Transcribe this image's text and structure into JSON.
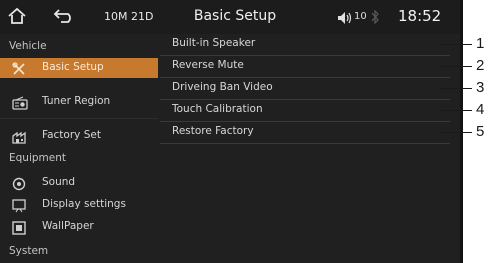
{
  "status_bar": {
    "home_icon": "home-icon",
    "back_icon": "back-arrow-icon",
    "date": "10M 21D",
    "title": "Basic Setup",
    "volume_icon": "speaker-icon",
    "volume": "10",
    "bluetooth_icon": "bluetooth-icon",
    "time": "18:52"
  },
  "sidebar": {
    "sections": [
      "Vehicle",
      "Equipment",
      "System"
    ],
    "items": [
      {
        "label": "Basic Setup",
        "icon": "wrench-screwdriver-icon",
        "selected": true
      },
      {
        "label": "Tuner Region",
        "icon": "radio-icon",
        "selected": false
      },
      {
        "label": "Factory Set",
        "icon": "factory-icon",
        "selected": false
      },
      {
        "label": "Sound",
        "icon": "sound-icon",
        "selected": false
      },
      {
        "label": "Display settings",
        "icon": "display-icon",
        "selected": false
      },
      {
        "label": "WallPaper",
        "icon": "wallpaper-icon",
        "selected": false
      }
    ]
  },
  "options": [
    {
      "label": "Built-in Speaker"
    },
    {
      "label": "Reverse Mute"
    },
    {
      "label": "Driveing Ban Video"
    },
    {
      "label": "Touch Calibration"
    },
    {
      "label": "Restore Factory"
    }
  ],
  "callouts": [
    "1",
    "2",
    "3",
    "4",
    "5"
  ],
  "colors": {
    "background": "#202020",
    "selected": "#c77a2e",
    "text": "#d8d8d8"
  }
}
